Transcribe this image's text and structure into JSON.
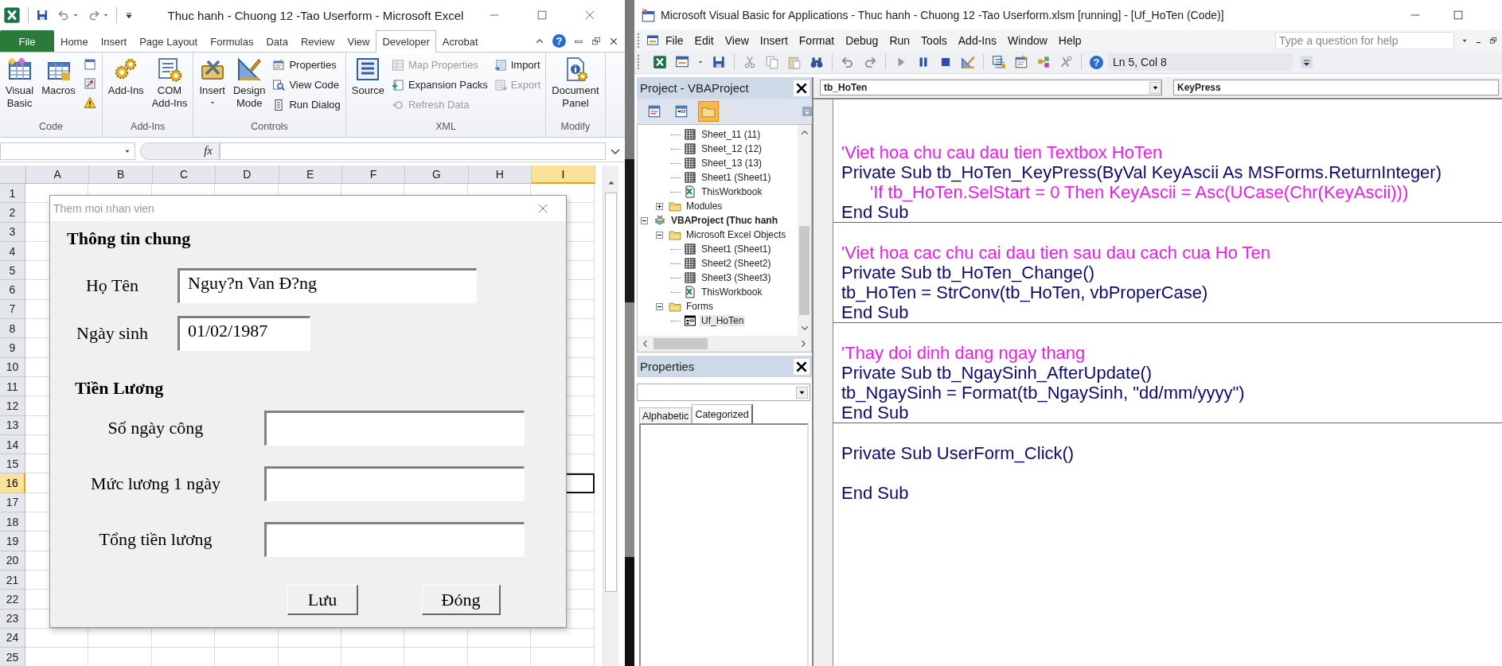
{
  "excel": {
    "title": "Thuc hanh - Chuong 12 -Tao Userform  -  Microsoft Excel",
    "tabs": [
      {
        "label": "File",
        "kind": "file",
        "selected": false
      },
      {
        "label": "Home",
        "kind": "tab",
        "selected": false
      },
      {
        "label": "Insert",
        "kind": "tab",
        "selected": false
      },
      {
        "label": "Page Layout",
        "kind": "tab",
        "selected": false
      },
      {
        "label": "Formulas",
        "kind": "tab",
        "selected": false
      },
      {
        "label": "Data",
        "kind": "tab",
        "selected": false
      },
      {
        "label": "Review",
        "kind": "tab",
        "selected": false
      },
      {
        "label": "View",
        "kind": "tab",
        "selected": false
      },
      {
        "label": "Developer",
        "kind": "tab",
        "selected": true
      },
      {
        "label": "Acrobat",
        "kind": "tab",
        "selected": false
      }
    ],
    "help_glyph": "?",
    "ribbon": [
      {
        "label": "Code",
        "items": [
          {
            "kind": "large",
            "label": "Visual Basic",
            "disabled": false
          },
          {
            "kind": "large",
            "label": "Macros",
            "disabled": false
          },
          {
            "kind": "icon"
          },
          {
            "kind": "icon"
          },
          {
            "kind": "icon"
          }
        ]
      },
      {
        "label": "Add-Ins",
        "items": [
          {
            "kind": "large",
            "label": "Add-Ins",
            "disabled": false
          },
          {
            "kind": "large",
            "label": "COM Add-Ins",
            "disabled": false
          }
        ]
      },
      {
        "label": "Controls",
        "items": [
          {
            "kind": "large-dropdown",
            "label": "Insert",
            "disabled": false
          },
          {
            "kind": "large",
            "label": "Design Mode",
            "disabled": false
          },
          {
            "kind": "small",
            "label": "Properties",
            "disabled": false
          },
          {
            "kind": "small",
            "label": "View Code",
            "disabled": false
          },
          {
            "kind": "small",
            "label": "Run Dialog",
            "disabled": false
          }
        ]
      },
      {
        "label": "XML",
        "items": [
          {
            "kind": "large",
            "label": "Source",
            "disabled": false
          },
          {
            "kind": "small",
            "label": "Map Properties",
            "disabled": true
          },
          {
            "kind": "small",
            "label": "Expansion Packs",
            "disabled": false
          },
          {
            "kind": "small",
            "label": "Refresh Data",
            "disabled": true
          },
          {
            "kind": "small",
            "label": "Import",
            "disabled": false
          },
          {
            "kind": "small",
            "label": "Export",
            "disabled": true
          }
        ]
      },
      {
        "label": "Modify",
        "items": [
          {
            "kind": "large",
            "label": "Document Panel",
            "disabled": false
          }
        ]
      }
    ],
    "fx": "fx",
    "sheet": {
      "columns": [
        {
          "label": "A",
          "selected": false
        },
        {
          "label": "B",
          "selected": false
        },
        {
          "label": "C",
          "selected": false
        },
        {
          "label": "D",
          "selected": false
        },
        {
          "label": "E",
          "selected": false
        },
        {
          "label": "F",
          "selected": false
        },
        {
          "label": "G",
          "selected": false
        },
        {
          "label": "H",
          "selected": false
        },
        {
          "label": "I",
          "selected": true
        }
      ],
      "rows": [
        {
          "label": "1",
          "selected": false
        },
        {
          "label": "2",
          "selected": false
        },
        {
          "label": "3",
          "selected": false
        },
        {
          "label": "4",
          "selected": false
        },
        {
          "label": "5",
          "selected": false
        },
        {
          "label": "6",
          "selected": false
        },
        {
          "label": "7",
          "selected": false
        },
        {
          "label": "8",
          "selected": false
        },
        {
          "label": "9",
          "selected": false
        },
        {
          "label": "10",
          "selected": false
        },
        {
          "label": "11",
          "selected": false
        },
        {
          "label": "12",
          "selected": false
        },
        {
          "label": "13",
          "selected": false
        },
        {
          "label": "14",
          "selected": false
        },
        {
          "label": "15",
          "selected": false
        },
        {
          "label": "16",
          "selected": true
        },
        {
          "label": "17",
          "selected": false
        },
        {
          "label": "18",
          "selected": false
        },
        {
          "label": "19",
          "selected": false
        },
        {
          "label": "20",
          "selected": false
        },
        {
          "label": "21",
          "selected": false
        },
        {
          "label": "22",
          "selected": false
        },
        {
          "label": "23",
          "selected": false
        },
        {
          "label": "24",
          "selected": false
        },
        {
          "label": "25",
          "selected": false
        }
      ]
    },
    "userform": {
      "title": "Them moi nhan vien",
      "sections": [
        {
          "heading": "Thông tin chung",
          "fields": [
            {
              "label": "Họ Tên",
              "value": "Nguy?n Van Đ?ng"
            },
            {
              "label": "Ngày sinh",
              "value": "01/02/1987"
            }
          ]
        },
        {
          "heading": "Tiền Lương",
          "fields": [
            {
              "label": "Số ngày công"
            },
            {
              "label": "Mức lương 1 ngày"
            },
            {
              "label": "Tổng tiền lương"
            }
          ]
        }
      ],
      "buttons": [
        "Lưu",
        "Đóng"
      ]
    }
  },
  "vba": {
    "title": "Microsoft Visual Basic for Applications - Thuc hanh - Chuong 12 -Tao Userform.xlsm [running] - [Uf_HoTen (Code)]",
    "menu": [
      "File",
      "Edit",
      "View",
      "Insert",
      "Format",
      "Debug",
      "Run",
      "Tools",
      "Add-Ins",
      "Window",
      "Help"
    ],
    "help_search": {
      "placeholder": "Type a question for help"
    },
    "toolbar": {
      "help_glyph": "?",
      "position": "Ln 5, Col 8"
    },
    "project": {
      "title": "Project - VBAProject",
      "toolbar": [
        {
          "on": false
        },
        {
          "on": false
        },
        {
          "on": true
        }
      ],
      "tree": [
        {
          "children": [
            {
              "children": [
                {
                  "label": "Sheet_11 (11)",
                  "kind": "sheet",
                  "selected": false
                },
                {
                  "label": "Sheet_12 (12)",
                  "kind": "sheet",
                  "selected": false
                },
                {
                  "label": "Sheet_13 (13)",
                  "kind": "sheet",
                  "selected": false
                },
                {
                  "label": "Sheet1 (Sheet1)",
                  "kind": "sheet",
                  "selected": false
                },
                {
                  "label": "ThisWorkbook",
                  "kind": "workbook",
                  "selected": false
                }
              ]
            },
            {
              "label": "Modules",
              "kind": "folder",
              "expanded": false,
              "selected": false
            }
          ]
        },
        {
          "label": "VBAProject (Thuc hanh",
          "kind": "project",
          "expanded": true,
          "selected": false,
          "children": [
            {
              "label": "Microsoft Excel Objects",
              "kind": "folder",
              "expanded": true,
              "selected": false,
              "children": [
                {
                  "label": "Sheet1 (Sheet1)",
                  "kind": "sheet",
                  "selected": false
                },
                {
                  "label": "Sheet2 (Sheet2)",
                  "kind": "sheet",
                  "selected": false
                },
                {
                  "label": "Sheet3 (Sheet3)",
                  "kind": "sheet",
                  "selected": false
                },
                {
                  "label": "ThisWorkbook",
                  "kind": "workbook",
                  "selected": false
                }
              ]
            },
            {
              "label": "Forms",
              "kind": "folder",
              "expanded": true,
              "selected": false,
              "children": [
                {
                  "label": "Uf_HoTen",
                  "kind": "form",
                  "selected": true
                }
              ]
            }
          ]
        }
      ]
    },
    "properties": {
      "title": "Properties",
      "tabs": [
        {
          "label": "Alphabetic",
          "selected": false
        },
        {
          "label": "Categorized",
          "selected": true
        }
      ]
    },
    "code": {
      "object": "tb_HoTen",
      "procedure": "KeyPress",
      "procedures": [
        {
          "lines": [
            {
              "kind": "comment",
              "text": "'Viet hoa chu cau dau tien Textbox HoTen"
            },
            {
              "kind": "code",
              "text": "Private Sub tb_HoTen_KeyPress(ByVal KeyAscii As MSForms.ReturnInteger)"
            },
            {
              "kind": "indented-comment",
              "text": "'If tb_HoTen.SelStart = 0 Then KeyAscii = Asc(UCase(Chr(KeyAscii)))"
            },
            {
              "kind": "code",
              "text": "End Sub"
            }
          ]
        },
        {
          "lines": [
            {
              "kind": "comment",
              "text": "'Viet hoa cac chu cai dau tien sau dau cach cua Ho Ten"
            },
            {
              "kind": "code",
              "text": "Private Sub tb_HoTen_Change()"
            },
            {
              "kind": "code",
              "text": "tb_HoTen = StrConv(tb_HoTen, vbProperCase)"
            },
            {
              "kind": "code",
              "text": "End Sub"
            }
          ]
        },
        {
          "lines": [
            {
              "kind": "comment",
              "text": "'Thay doi dinh dang ngay thang"
            },
            {
              "kind": "code",
              "text": "Private Sub tb_NgaySinh_AfterUpdate()"
            },
            {
              "kind": "code",
              "text": "tb_NgaySinh = Format(tb_NgaySinh, \"dd/mm/yyyy\")"
            },
            {
              "kind": "code",
              "text": "End Sub"
            }
          ]
        },
        {
          "lines": [
            {
              "kind": "code",
              "text": "Private Sub UserForm_Click()"
            },
            {
              "kind": "blank"
            },
            {
              "kind": "code",
              "text": "End Sub"
            }
          ]
        }
      ]
    }
  }
}
